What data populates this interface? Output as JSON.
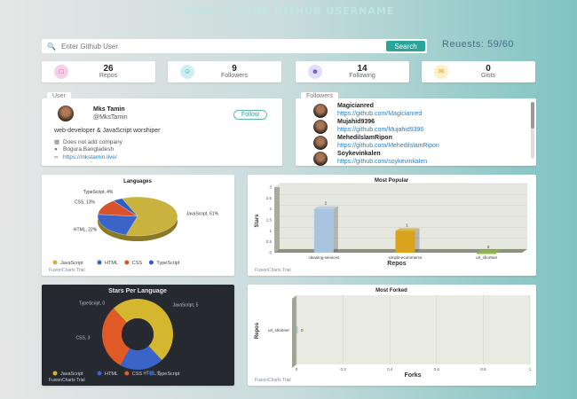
{
  "page": {
    "title": "SEARCH YOUR GITHUB USERNAME"
  },
  "search": {
    "placeholder": "Enter Github User",
    "value": "",
    "button_label": "Search"
  },
  "requests": {
    "label": "Reuests: 59/60"
  },
  "stats": [
    {
      "value": "26",
      "label": "Repos",
      "icon": "repo-icon",
      "color": "#f5d0e6",
      "icon_color": "#c2459c"
    },
    {
      "value": "9",
      "label": "Followers",
      "icon": "followers-icon",
      "color": "#cfeef1",
      "icon_color": "#2ba5b5"
    },
    {
      "value": "14",
      "label": "Following",
      "icon": "following-icon",
      "color": "#e3dcfa",
      "icon_color": "#6a52d6"
    },
    {
      "value": "0",
      "label": "Gists",
      "icon": "gists-icon",
      "color": "#fdf0c9",
      "icon_color": "#d6a41a"
    }
  ],
  "user": {
    "tab": "User",
    "name": "Mks Tamin",
    "handle": "@MksTamin",
    "follow_label": "Follow",
    "bio": "web-developer & JavaScript worshiper",
    "company": "Does not add company",
    "location": "Bogura,Bangladesh",
    "blog": "https://mkstamin.live/"
  },
  "followers": {
    "tab": "Followers",
    "items": [
      {
        "name": "Magicianred",
        "url": "https://github.com/Magicianred"
      },
      {
        "name": "Mujahid9396",
        "url": "https://github.com/Mujahid9396"
      },
      {
        "name": "MehedilslamRipon",
        "url": "https://github.com/MehedilslamRipon"
      },
      {
        "name": "Soykevinkalen",
        "url": "https://github.com/soykevinkalen"
      }
    ]
  },
  "trial_label": "FusionCharts Trial",
  "chart_data": [
    {
      "type": "pie",
      "title": "Languages",
      "categories": [
        "JavaScript",
        "HTML",
        "CSS",
        "TypeScript"
      ],
      "values": [
        61,
        22,
        13,
        4
      ],
      "labels": [
        "JavaScript, 61%",
        "HTML, 22%",
        "CSS, 13%",
        "TypeScript, 4%"
      ],
      "colors": [
        "#c9b33e",
        "#3a64c8",
        "#d9532c",
        "#2c5ec4"
      ],
      "legend": "bottom"
    },
    {
      "type": "bar",
      "title": "Most Popular",
      "categories": [
        "cleaning-services",
        "simple-ecommerce",
        "url_shortner"
      ],
      "values": [
        2,
        1,
        0
      ],
      "value_labels": [
        "2",
        "1",
        "0"
      ],
      "xlabel": "Repos",
      "ylabel": "Stars",
      "ylim": [
        0,
        3
      ],
      "yticks": [
        "0",
        "0.5",
        "1",
        "1.5",
        "2",
        "2.5",
        "3"
      ],
      "colors": [
        "#a9c4de",
        "#d8a21c",
        "#8dbf3a"
      ]
    },
    {
      "type": "pie",
      "title": "Stars Per Language",
      "categories": [
        "JavaScript",
        "HTML",
        "CSS",
        "TypeScript"
      ],
      "values": [
        5,
        2,
        3,
        0
      ],
      "labels": [
        "JavaScript, 5",
        "HTML, 2",
        "CSS, 3",
        "TypeScript, 0"
      ],
      "colors": [
        "#d4b72e",
        "#3a64c8",
        "#e05a27",
        "#2c5ec4"
      ],
      "legend": "bottom"
    },
    {
      "type": "bar",
      "title": "Most Forked",
      "categories": [
        "url_shortner"
      ],
      "values": [
        0
      ],
      "value_labels": [
        "0"
      ],
      "xlabel": "Forks",
      "ylabel": "Repos",
      "xlim": [
        0,
        1
      ],
      "xticks": [
        "0",
        "0.2",
        "0.4",
        "0.6",
        "0.8",
        "1"
      ]
    }
  ]
}
